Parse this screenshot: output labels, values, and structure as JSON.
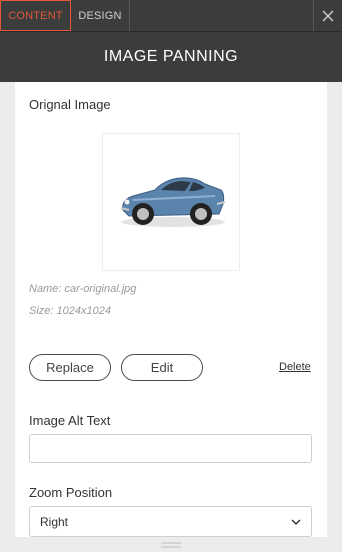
{
  "tabs": {
    "content": "CONTENT",
    "design": "DESIGN"
  },
  "header": {
    "title": "IMAGE PANNING"
  },
  "image": {
    "section_label": "Orignal Image",
    "name": "Name: car-original.jpg",
    "size": "Size: 1024x1024",
    "replace_label": "Replace",
    "edit_label": "Edit",
    "delete_label": "Delete"
  },
  "alt_text": {
    "label": "Image Alt Text",
    "value": ""
  },
  "zoom": {
    "label": "Zoom Position",
    "value": "Right"
  },
  "icons": {
    "close": "close-icon",
    "chevron": "chevron-down-icon",
    "grip": "drag-handle-icon"
  },
  "colors": {
    "dark": "#3b3c3c",
    "accent": "#e2583a",
    "car_body": "#5b84ad"
  }
}
